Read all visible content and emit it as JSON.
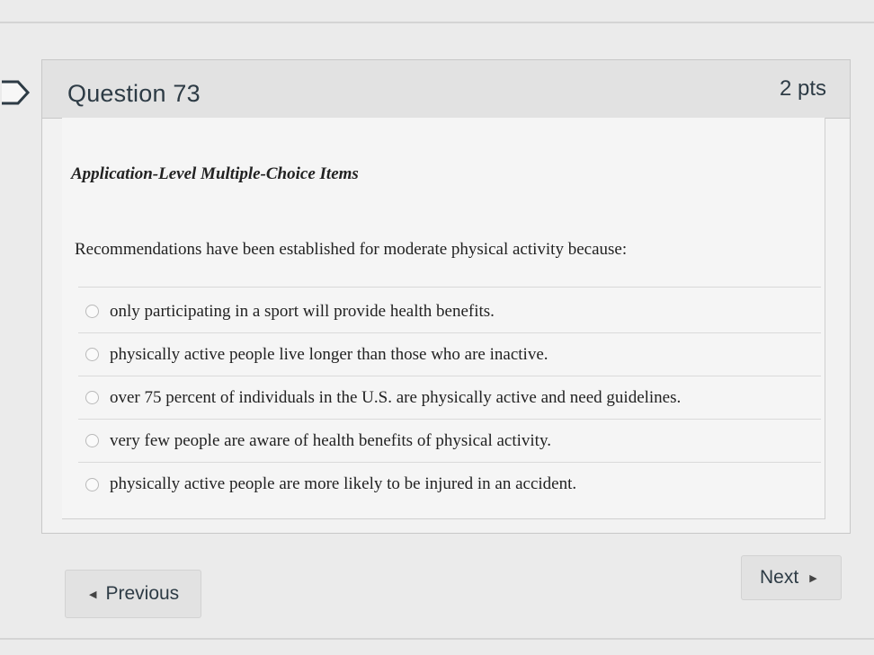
{
  "question": {
    "title": "Question 73",
    "points": "2 pts",
    "category": "Application-Level Multiple-Choice Items",
    "prompt": "Recommendations have been established for moderate physical activity because:",
    "answers": [
      {
        "label": "only participating in a sport will provide health benefits."
      },
      {
        "label": "physically active people live longer than those who are inactive."
      },
      {
        "label": "over 75 percent of individuals in the U.S. are physically active and need guidelines."
      },
      {
        "label": "very few people are aware of health benefits of physical activity."
      },
      {
        "label": "physically active people are more likely to be injured in an accident."
      }
    ]
  },
  "navigation": {
    "previous_label": "Previous",
    "next_label": "Next",
    "previous_arrow": "◀",
    "next_arrow": "▶"
  }
}
